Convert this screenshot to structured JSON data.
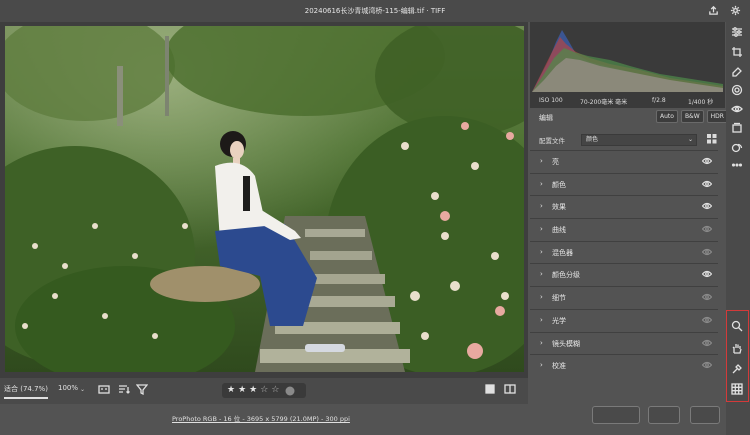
{
  "window": {
    "title": "20240616长沙青城湾桥-115-编辑.tif · TIFF"
  },
  "colors": {
    "accent_highlight": "#d33a3a",
    "panel_bg": "#535353",
    "dark_bg": "#3a3a3a"
  },
  "bottombar": {
    "zoom_fit": "适合 (74.7%)",
    "zoom_100": "100%",
    "rating": {
      "filled": 3,
      "total": 5
    }
  },
  "info": {
    "text": "ProPhoto RGB - 16 位 - 3695 x 5799 (21.0MP) - 300 ppi"
  },
  "metadata": {
    "iso": "ISO 100",
    "lens": "70-200毫米 毫米",
    "aperture": "f/2.8",
    "shutter": "1/400 秒"
  },
  "edit": {
    "heading": "编辑",
    "modes": [
      "Auto",
      "B&W",
      "HDR"
    ],
    "profile_label": "配置文件",
    "profile_value": "颜色"
  },
  "sections": [
    {
      "label": "亮",
      "eye_active": true
    },
    {
      "label": "颜色",
      "eye_active": true
    },
    {
      "label": "效果",
      "eye_active": true
    },
    {
      "label": "曲线",
      "eye_active": false
    },
    {
      "label": "混色器",
      "eye_active": false
    },
    {
      "label": "颜色分级",
      "eye_active": true
    },
    {
      "label": "细节",
      "eye_active": false
    },
    {
      "label": "光学",
      "eye_active": false
    },
    {
      "label": "镜头模糊",
      "eye_active": false
    },
    {
      "label": "校准",
      "eye_active": false
    }
  ],
  "icons": {
    "titlebar": [
      "export-icon",
      "gear-icon"
    ],
    "tools_top": [
      "edit-sliders-icon",
      "crop-icon",
      "eraser-icon",
      "masking-icon",
      "redeye-icon",
      "presets-icon",
      "snapshots-icon",
      "more-icon"
    ],
    "tools_bottom": [
      "zoom-icon",
      "hand-icon",
      "sampler-icon",
      "grid-overlay-icon"
    ]
  }
}
